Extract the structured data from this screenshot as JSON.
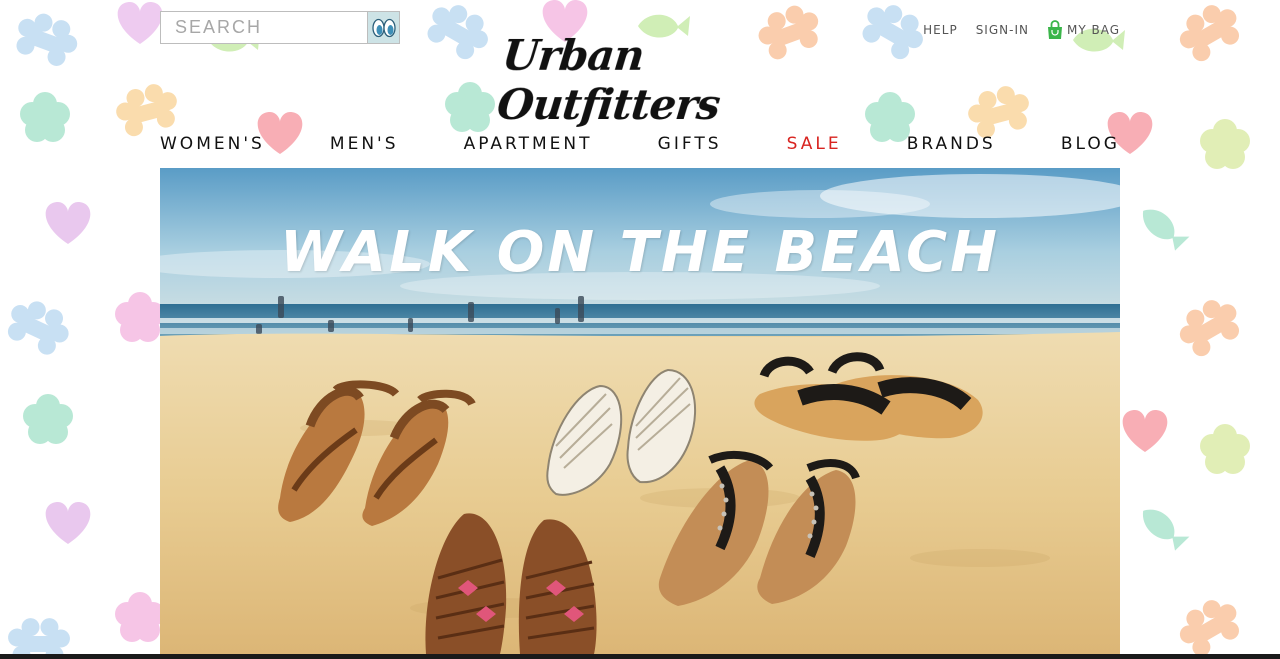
{
  "search": {
    "placeholder": "SEARCH",
    "icon": "search-eyes-icon"
  },
  "utility": {
    "help": "HELP",
    "sign_in": "SIGN-IN",
    "bag": "MY BAG",
    "bag_icon": "shopping-bag-icon"
  },
  "logo": {
    "text": "Urban Outfitters"
  },
  "nav": [
    {
      "label": "WOMEN'S"
    },
    {
      "label": "MEN'S"
    },
    {
      "label": "APARTMENT"
    },
    {
      "label": "GIFTS"
    },
    {
      "label": "SALE",
      "color": "#d8231f"
    },
    {
      "label": "BRANDS"
    },
    {
      "label": "BLOG"
    }
  ],
  "hero": {
    "title": "WALK ON THE BEACH"
  },
  "colors": {
    "accent": "#d8231f",
    "bag_green": "#3bb54a",
    "search_button": "#cde3e6"
  }
}
